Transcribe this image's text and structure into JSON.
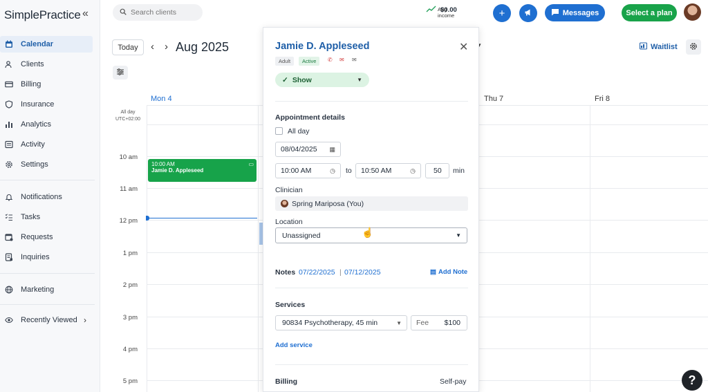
{
  "sidebar": {
    "logo": "SimplePractice",
    "collapse_icon": "double-chevron-left-icon",
    "items": [
      {
        "label": "Calendar",
        "icon": "calendar-icon",
        "active": true
      },
      {
        "label": "Clients",
        "icon": "users-icon"
      },
      {
        "label": "Billing",
        "icon": "credit-card-icon"
      },
      {
        "label": "Insurance",
        "icon": "shield-icon"
      },
      {
        "label": "Analytics",
        "icon": "bar-chart-icon"
      },
      {
        "label": "Activity",
        "icon": "list-icon"
      },
      {
        "label": "Settings",
        "icon": "gear-icon"
      },
      {
        "label": "Notifications",
        "icon": "bell-icon"
      },
      {
        "label": "Tasks",
        "icon": "checklist-icon"
      },
      {
        "label": "Requests",
        "icon": "calendar-request-icon"
      },
      {
        "label": "Inquiries",
        "icon": "inbox-icon"
      },
      {
        "label": "Marketing",
        "icon": "globe-icon"
      },
      {
        "label": "Recently Viewed",
        "icon": "eye-icon"
      }
    ]
  },
  "topbar": {
    "search_placeholder": "Search clients",
    "income_label": "Aug income",
    "income_value": "$0.00",
    "messages_label": "Messages",
    "plan_label": "Select a plan"
  },
  "calendar": {
    "today_label": "Today",
    "month": "Aug 2025",
    "waitlist_label": "Waitlist",
    "days": [
      "Mon 4",
      "Thu 7",
      "Fri 8"
    ],
    "allday_label": "All day",
    "timezone": "UTC+02:00",
    "times": [
      "10 am",
      "11 am",
      "12 pm",
      "1 pm",
      "2 pm",
      "3 pm",
      "4 pm",
      "5 pm"
    ],
    "event": {
      "time": "10:00 AM",
      "name": "Jamie D. Appleseed"
    }
  },
  "panel": {
    "client_name": "Jamie D. Appleseed",
    "tags": [
      "Adult",
      "Active"
    ],
    "status": "Show",
    "appointment_details_title": "Appointment details",
    "all_day_label": "All day",
    "date": "08/04/2025",
    "start_time": "10:00 AM",
    "to_label": "to",
    "end_time": "10:50 AM",
    "duration": "50",
    "duration_unit": "min",
    "clinician_label": "Clinician",
    "clinician": "Spring Mariposa (You)",
    "location_label": "Location",
    "location_value": "Unassigned",
    "notes_label": "Notes",
    "note_date_1": "07/22/2025",
    "note_sep": "|",
    "note_date_2": "07/12/2025",
    "add_note_label": "Add Note",
    "services_title": "Services",
    "service": "90834 Psychotherapy, 45 min",
    "fee_label": "Fee",
    "fee_value": "$100",
    "add_service_label": "Add service",
    "billing_title": "Billing",
    "billing_value": "Self-pay"
  },
  "help_label": "?"
}
